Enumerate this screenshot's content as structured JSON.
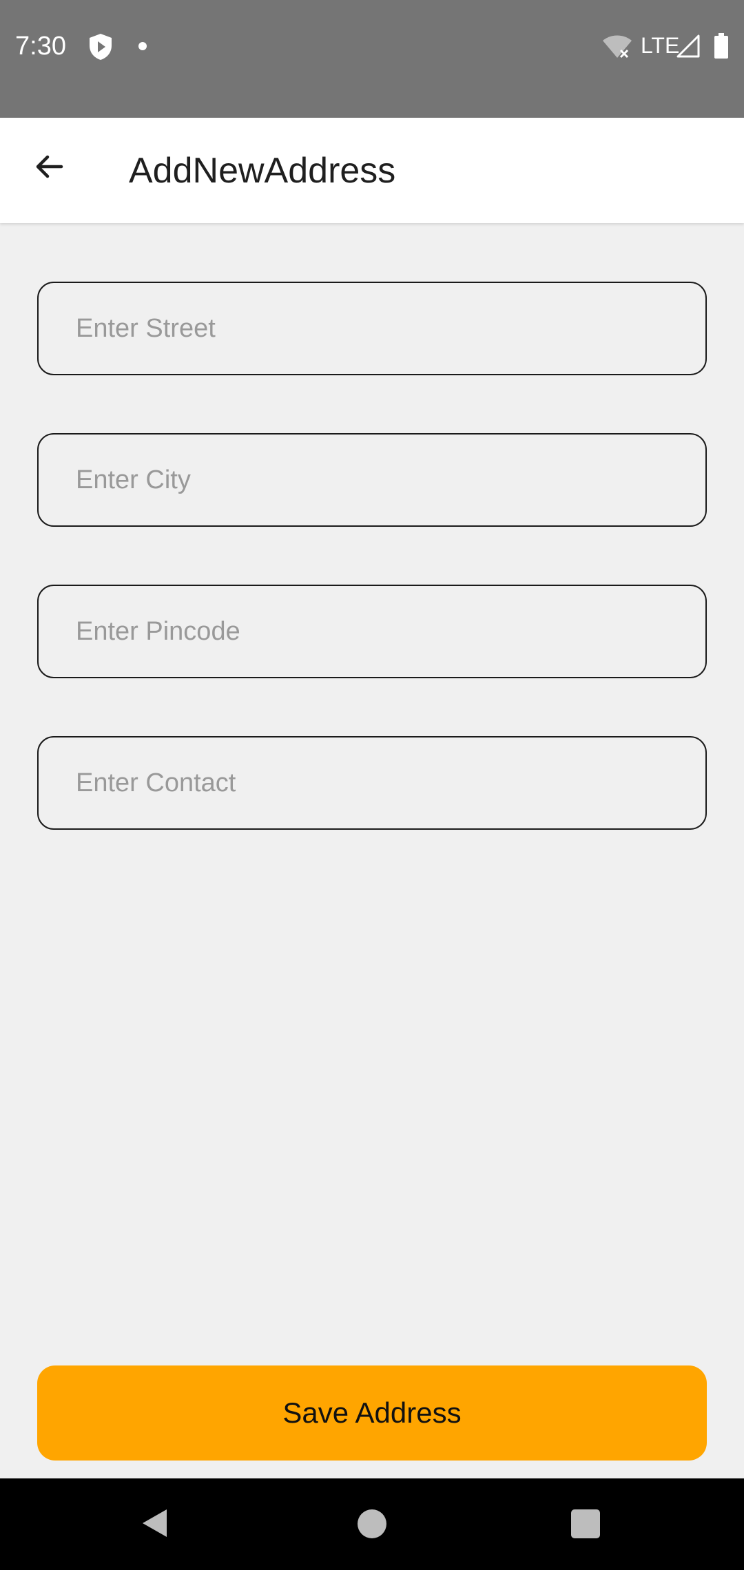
{
  "status_bar": {
    "time": "7:30",
    "network_label": "LTE",
    "icons": [
      "shield-icon",
      "notification-dot",
      "wifi-off-icon",
      "cell-signal-icon",
      "battery-icon"
    ],
    "background_color": "#757575"
  },
  "app_bar": {
    "title": "AddNewAddress",
    "back_icon": "arrow-back-icon"
  },
  "form": {
    "fields": [
      {
        "name": "street",
        "placeholder": "Enter Street",
        "value": ""
      },
      {
        "name": "city",
        "placeholder": "Enter City",
        "value": ""
      },
      {
        "name": "pincode",
        "placeholder": "Enter Pincode",
        "value": ""
      },
      {
        "name": "contact",
        "placeholder": "Enter Contact",
        "value": ""
      }
    ]
  },
  "actions": {
    "save_label": "Save Address",
    "save_color": "#ffa500"
  },
  "nav_bar": {
    "icons": [
      "nav-back-icon",
      "nav-home-icon",
      "nav-recents-icon"
    ]
  },
  "colors": {
    "background": "#f0f0f0",
    "accent": "#ffa500",
    "border": "#1a1a1a"
  }
}
